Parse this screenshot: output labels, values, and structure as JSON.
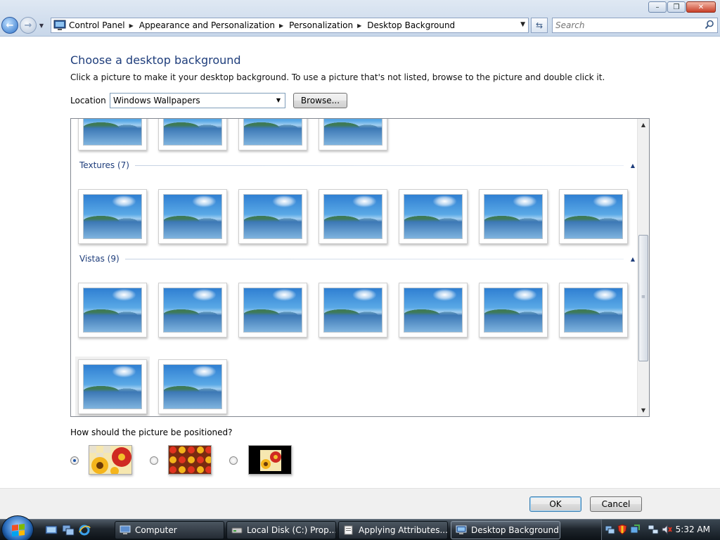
{
  "window": {
    "minimize_glyph": "–",
    "maximize_glyph": "❒",
    "close_glyph": "✕"
  },
  "address": {
    "breadcrumbs": [
      "Control Panel",
      "Appearance and Personalization",
      "Personalization",
      "Desktop Background"
    ]
  },
  "search": {
    "placeholder": "Search"
  },
  "page": {
    "title": "Choose a desktop background",
    "description": "Click a picture to make it your desktop background. To use a picture that's not listed, browse to the picture and double click it.",
    "location_label": "Location",
    "location_value": "Windows Wallpapers",
    "browse_label": "Browse..."
  },
  "gallery": {
    "categories": [
      {
        "label": "Textures (7)",
        "count": 7
      },
      {
        "label": "Vistas (9)",
        "count": 9
      }
    ],
    "selected": "vistas-8"
  },
  "positioning": {
    "question": "How should the picture be positioned?",
    "options": [
      {
        "name": "fit-to-screen",
        "checked": true
      },
      {
        "name": "tile",
        "checked": false
      },
      {
        "name": "center",
        "checked": false
      }
    ]
  },
  "buttons": {
    "ok": "OK",
    "cancel": "Cancel"
  },
  "taskbar": {
    "tasks": [
      {
        "label": "Computer",
        "active": false
      },
      {
        "label": "Local Disk (C:) Prop...",
        "active": false
      },
      {
        "label": "Applying Attributes...",
        "active": false
      },
      {
        "label": "Desktop Background",
        "active": true
      }
    ],
    "clock": "5:32 AM"
  },
  "colors": {
    "heading": "#1e3d7b",
    "sky": "#5aa9e6",
    "water": "#3c78b5",
    "hills": "#3e7a57",
    "taskbar": "#1f262d"
  }
}
